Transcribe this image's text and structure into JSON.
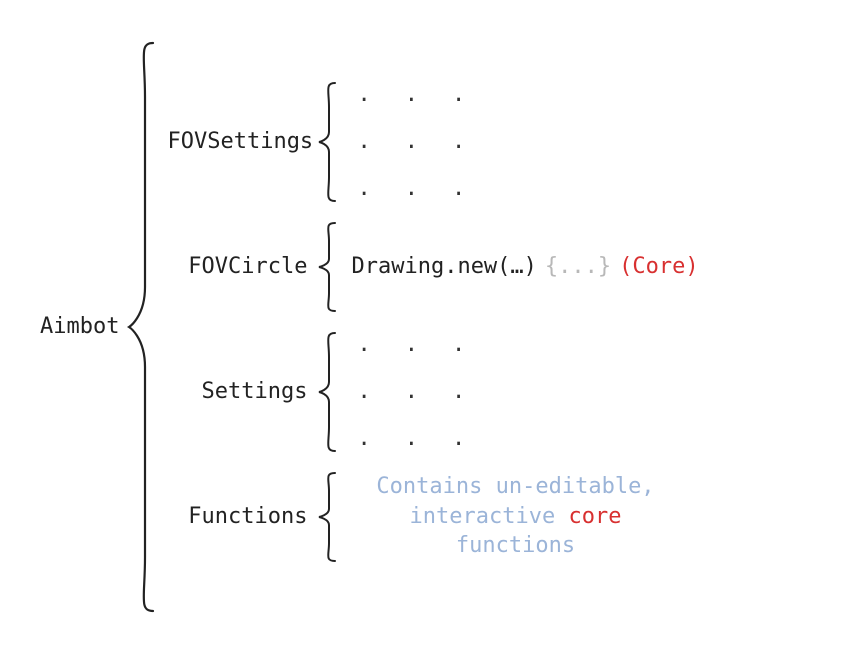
{
  "root_label": "Aimbot",
  "children": [
    {
      "label": "FOVSettings",
      "type": "dots"
    },
    {
      "label": "FOVCircle",
      "type": "inline",
      "parts": {
        "main": "Drawing.new(…)",
        "gray": "{...}",
        "red": "(Core)"
      }
    },
    {
      "label": "Settings",
      "type": "dots"
    },
    {
      "label": "Functions",
      "type": "desc",
      "desc": {
        "pre": "Contains un-editable, interactive ",
        "core": "core",
        "post": " functions"
      }
    }
  ],
  "colors": {
    "red": "#d83030",
    "blue": "#9bb4d8",
    "gray": "#b8b8b8"
  }
}
